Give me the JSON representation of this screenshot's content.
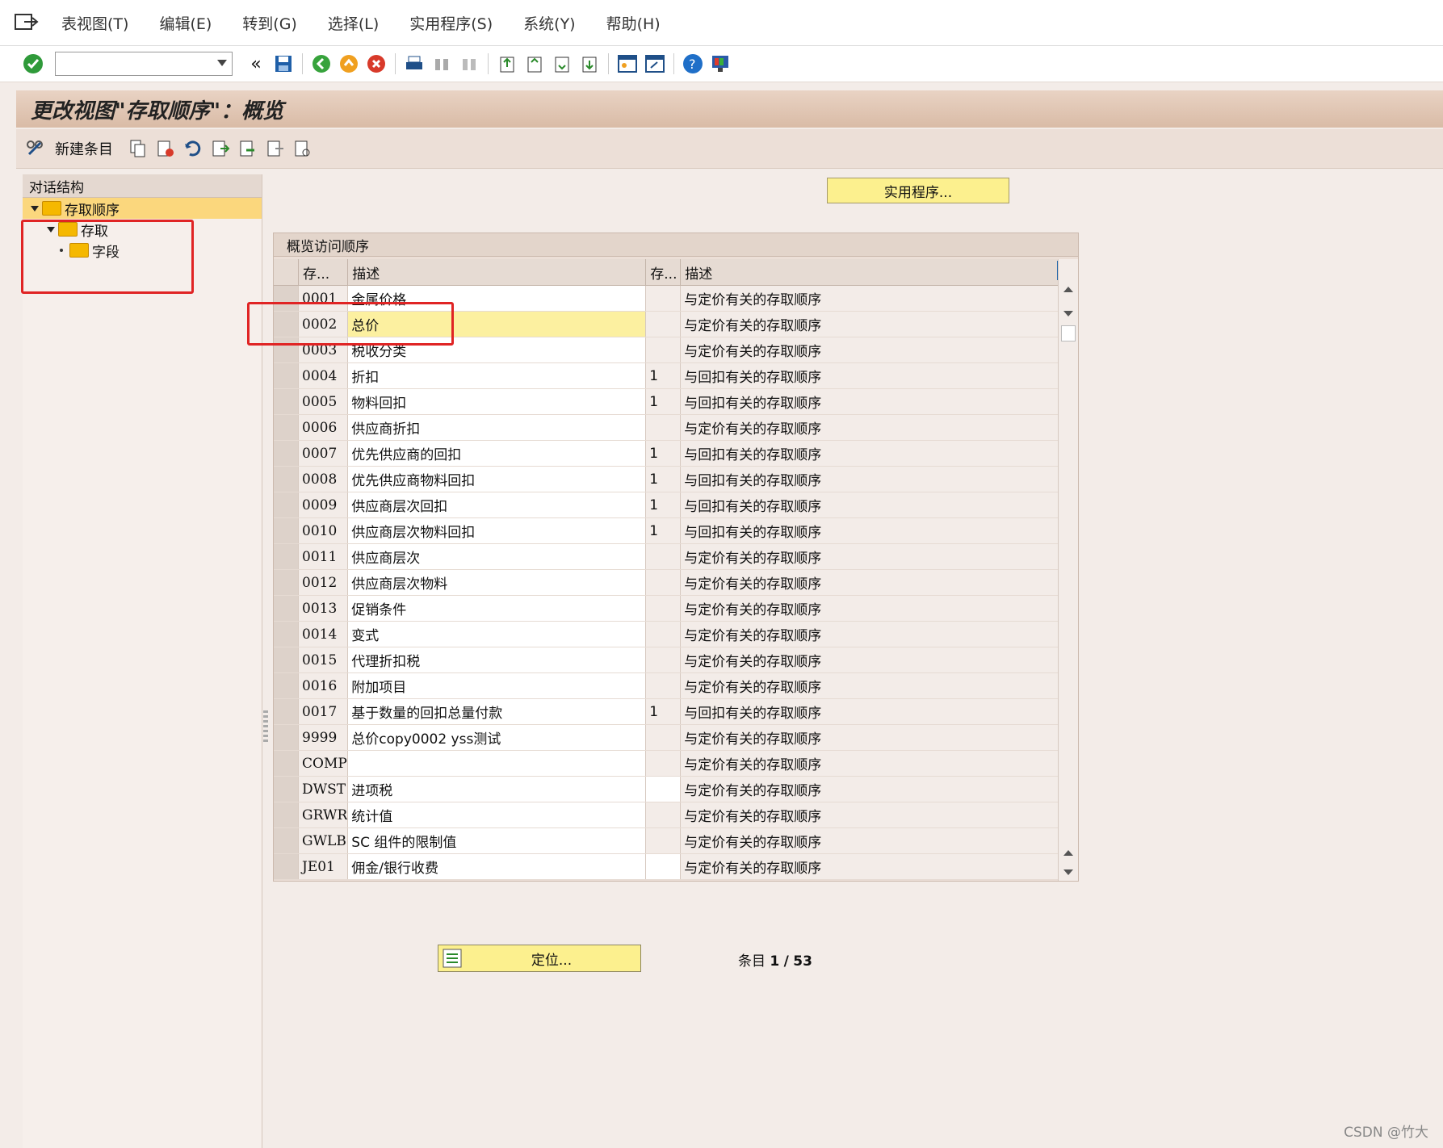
{
  "menubar": {
    "items": [
      "表视图(T)",
      "编辑(E)",
      "转到(G)",
      "选择(L)",
      "实用程序(S)",
      "系统(Y)",
      "帮助(H)"
    ]
  },
  "toolbar": {
    "command_value": "",
    "back_glyph": "«"
  },
  "title": "更改视图\"存取顺序\"：概览",
  "apptoolbar": {
    "new_entry": "新建条目"
  },
  "leftpane": {
    "header": "对话结构",
    "tree": [
      {
        "label": "存取顺序",
        "selected": true
      },
      {
        "label": "存取"
      },
      {
        "label": "字段"
      }
    ]
  },
  "util_button": "实用程序...",
  "grid": {
    "title": "概览访问顺序",
    "headers": [
      "存...",
      "描述",
      "存...",
      "描述"
    ],
    "rows": [
      {
        "key": "0001",
        "desc": "金属价格",
        "flag": "",
        "desc2": "与定价有关的存取顺序"
      },
      {
        "key": "0002",
        "desc": "总价",
        "flag": "",
        "desc2": "与定价有关的存取顺序",
        "active": true
      },
      {
        "key": "0003",
        "desc": "税收分类",
        "flag": "",
        "desc2": "与定价有关的存取顺序"
      },
      {
        "key": "0004",
        "desc": "折扣",
        "flag": "1",
        "desc2": "与回扣有关的存取顺序"
      },
      {
        "key": "0005",
        "desc": "物料回扣",
        "flag": "1",
        "desc2": "与回扣有关的存取顺序"
      },
      {
        "key": "0006",
        "desc": "供应商折扣",
        "flag": "",
        "desc2": "与定价有关的存取顺序"
      },
      {
        "key": "0007",
        "desc": "优先供应商的回扣",
        "flag": "1",
        "desc2": "与回扣有关的存取顺序"
      },
      {
        "key": "0008",
        "desc": "优先供应商物料回扣",
        "flag": "1",
        "desc2": "与回扣有关的存取顺序"
      },
      {
        "key": "0009",
        "desc": "供应商层次回扣",
        "flag": "1",
        "desc2": "与回扣有关的存取顺序"
      },
      {
        "key": "0010",
        "desc": "供应商层次物料回扣",
        "flag": "1",
        "desc2": "与回扣有关的存取顺序"
      },
      {
        "key": "0011",
        "desc": "供应商层次",
        "flag": "",
        "desc2": "与定价有关的存取顺序"
      },
      {
        "key": "0012",
        "desc": "供应商层次物料",
        "flag": "",
        "desc2": "与定价有关的存取顺序"
      },
      {
        "key": "0013",
        "desc": "促销条件",
        "flag": "",
        "desc2": "与定价有关的存取顺序"
      },
      {
        "key": "0014",
        "desc": "变式",
        "flag": "",
        "desc2": "与定价有关的存取顺序"
      },
      {
        "key": "0015",
        "desc": "代理折扣税",
        "flag": "",
        "desc2": "与定价有关的存取顺序"
      },
      {
        "key": "0016",
        "desc": "附加项目",
        "flag": "",
        "desc2": "与定价有关的存取顺序"
      },
      {
        "key": "0017",
        "desc": "基于数量的回扣总量付款",
        "flag": "1",
        "desc2": "与回扣有关的存取顺序"
      },
      {
        "key": "9999",
        "desc": "总价copy0002 yss测试",
        "flag": "",
        "desc2": "与定价有关的存取顺序"
      },
      {
        "key": "COMP",
        "desc": "",
        "flag": "",
        "desc2": "与定价有关的存取顺序"
      },
      {
        "key": "DWST",
        "desc": "进项税",
        "flag": "",
        "desc2": "与定价有关的存取顺序",
        "flag_white": true
      },
      {
        "key": "GRWR",
        "desc": "统计值",
        "flag": "",
        "desc2": "与定价有关的存取顺序"
      },
      {
        "key": "GWLB",
        "desc": "SC 组件的限制值",
        "flag": "",
        "desc2": "与定价有关的存取顺序"
      },
      {
        "key": "JE01",
        "desc": "佣金/银行收费",
        "flag": "",
        "desc2": "与定价有关的存取顺序",
        "flag_white": true
      }
    ]
  },
  "locate_button": "定位...",
  "entries": {
    "label": "条目",
    "current": "1",
    "total": "53"
  },
  "watermark": "CSDN @竹大"
}
